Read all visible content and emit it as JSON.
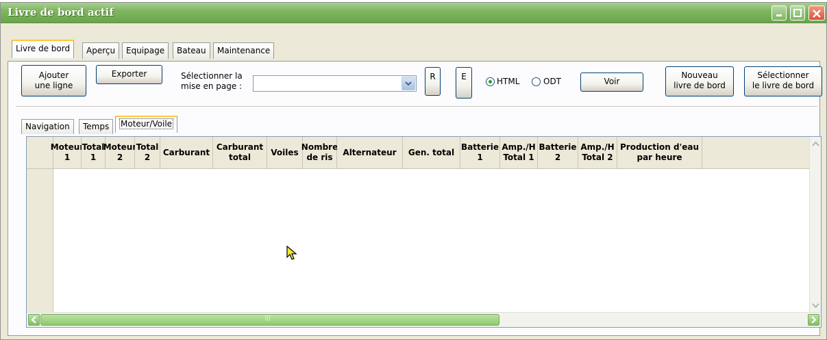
{
  "window": {
    "title": "Livre de bord actif"
  },
  "tabs": [
    {
      "label": "Livre de bord",
      "active": true
    },
    {
      "label": "Aperçu",
      "active": false
    },
    {
      "label": "Equipage",
      "active": false
    },
    {
      "label": "Bateau",
      "active": false
    },
    {
      "label": "Maintenance",
      "active": false
    }
  ],
  "toolbar": {
    "add_line_l1": "Ajouter",
    "add_line_l2": "une ligne",
    "export": "Exporter",
    "layout_label_l1": "Sélectionner la",
    "layout_label_l2": "mise en page :",
    "layout_value": "",
    "r": "R",
    "e": "E",
    "radio_html": "HTML",
    "radio_odt": "ODT",
    "selected_format": "HTML",
    "view": "Voir",
    "new_log_l1": "Nouveau",
    "new_log_l2": "livre de bord",
    "select_log_l1": "Sélectionner",
    "select_log_l2": "le livre de bord"
  },
  "subtabs": [
    {
      "label": "Navigation",
      "active": false
    },
    {
      "label": "Temps",
      "active": false
    },
    {
      "label": "Moteur/Voile",
      "active": true
    }
  ],
  "grid": {
    "columns": [
      {
        "l1": "Moteur",
        "l2": "1"
      },
      {
        "l1": "Total",
        "l2": "1"
      },
      {
        "l1": "Moteur",
        "l2": "2"
      },
      {
        "l1": "Total",
        "l2": "2"
      },
      {
        "l1": "Carburant",
        "l2": ""
      },
      {
        "l1": "Carburant",
        "l2": "total"
      },
      {
        "l1": "Voiles",
        "l2": ""
      },
      {
        "l1": "Nombre",
        "l2": "de ris"
      },
      {
        "l1": "Alternateur",
        "l2": ""
      },
      {
        "l1": "Gen. total",
        "l2": ""
      },
      {
        "l1": "Batterie",
        "l2": "1"
      },
      {
        "l1": "Amp./H",
        "l2": "Total 1"
      },
      {
        "l1": "Batterie",
        "l2": "2"
      },
      {
        "l1": "Amp./H",
        "l2": "Total 2"
      },
      {
        "l1": "Production d'eau",
        "l2": "par heure"
      }
    ],
    "rows": [],
    "hscroll_grip": "|||"
  },
  "icons": [
    "minimize-icon",
    "maximize-icon",
    "close-icon",
    "chevron-down-icon",
    "scroll-up-icon",
    "scroll-down-icon",
    "scroll-left-icon",
    "scroll-right-icon",
    "cursor-icon"
  ],
  "colors": {
    "titlebar": "#7fb660",
    "tab_highlight": "#ffc83c",
    "window_bg": "#ece9d8"
  }
}
